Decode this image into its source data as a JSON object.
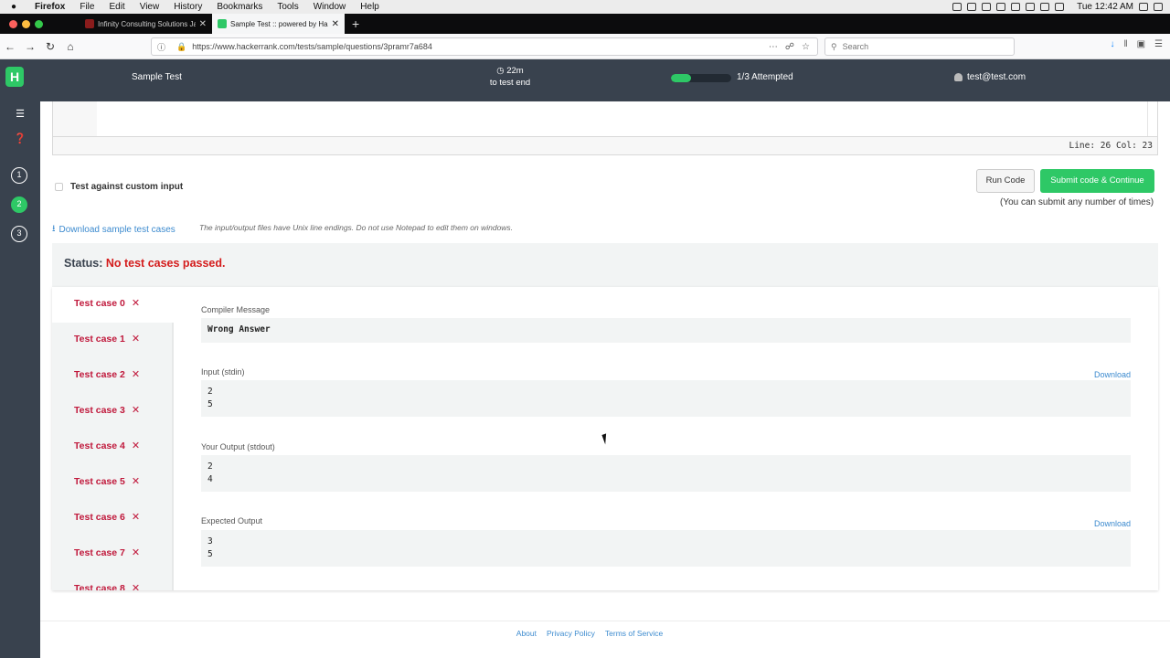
{
  "os_menubar": {
    "app_name": "Firefox",
    "menus": [
      "File",
      "Edit",
      "View",
      "History",
      "Bookmarks",
      "Tools",
      "Window",
      "Help"
    ],
    "clock": "Tue 12:42 AM"
  },
  "browser": {
    "tabs": [
      {
        "title": "Infinity Consulting Solutions Ja",
        "active": false
      },
      {
        "title": "Sample Test :: powered by Hack",
        "active": true
      }
    ],
    "url": "https://www.hackerrank.com/tests/sample/questions/3pramr7a684",
    "search_placeholder": "Search"
  },
  "header": {
    "logo": "H",
    "test_title": "Sample Test",
    "timer_value": "22m",
    "timer_label": "to test end",
    "progress_fraction": 0.33,
    "attempted": "1/3 Attempted",
    "user_email": "test@test.com"
  },
  "sidebar": {
    "questions": [
      "1",
      "2",
      "3"
    ],
    "active_question": "2"
  },
  "editor": {
    "cursor_position": "Line: 26 Col: 23"
  },
  "controls": {
    "custom_input_label": "Test against custom input",
    "run_label": "Run Code",
    "submit_label": "Submit code & Continue",
    "submit_note": "(You can submit any number of times)",
    "download_samples": "Download sample test cases",
    "line_endings_note": "The input/output files have Unix line endings. Do not use Notepad to edit them on windows."
  },
  "status": {
    "label": "Status:",
    "value": "No test cases passed."
  },
  "test_cases": [
    "Test case 0",
    "Test case 1",
    "Test case 2",
    "Test case 3",
    "Test case 4",
    "Test case 5",
    "Test case 6",
    "Test case 7",
    "Test case 8"
  ],
  "active_case_index": 0,
  "result": {
    "compiler_label": "Compiler Message",
    "compiler_message": "Wrong Answer",
    "input_label": "Input (stdin)",
    "input_value": "2\n5",
    "your_output_label": "Your Output (stdout)",
    "your_output_value": "2\n4",
    "expected_label": "Expected Output",
    "expected_value": "3\n5",
    "download_label": "Download"
  },
  "footer": {
    "links": [
      "About",
      "Privacy Policy",
      "Terms of Service"
    ]
  },
  "colors": {
    "accent_green": "#2ec866",
    "header_dark": "#39424e",
    "error_red": "#d41c1c",
    "link_blue": "#3d8bcf"
  }
}
